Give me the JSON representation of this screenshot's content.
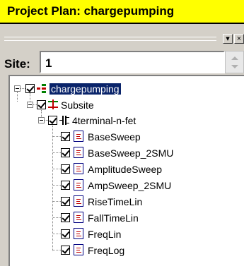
{
  "window": {
    "title": "Project Plan: chargepumping"
  },
  "toolbar": {
    "down_btn": "▾",
    "close_btn": "×"
  },
  "site": {
    "label": "Site:",
    "value": "1"
  },
  "tree": {
    "root": "chargepumping",
    "subsite": "Subsite",
    "device": "4terminal-n-fet",
    "tests": [
      "BaseSweep",
      "BaseSweep_2SMU",
      "AmplitudeSweep",
      "AmpSweep_2SMU",
      "RiseTimeLin",
      "FallTimeLin",
      "FreqLin",
      "FreqLog"
    ]
  }
}
